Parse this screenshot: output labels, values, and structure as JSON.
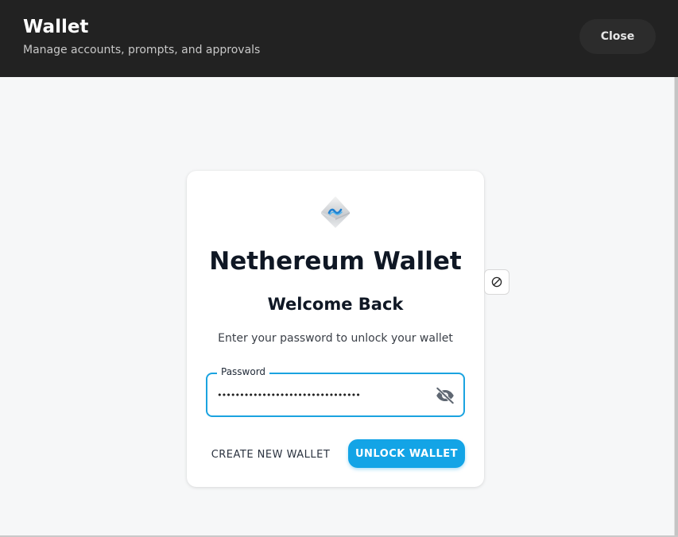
{
  "header": {
    "title": "Wallet",
    "subtitle": "Manage accounts, prompts, and approvals",
    "close_label": "Close"
  },
  "card": {
    "logo_icon": "nethereum-logo-icon",
    "app_title": "Nethereum Wallet",
    "welcome": "Welcome Back",
    "instructions": "Enter your password to unlock your wallet",
    "password": {
      "label": "Password",
      "value": "••••••••••••••••••••••••••••••••",
      "toggle_icon": "eye-off-icon"
    },
    "create_label": "CREATE NEW WALLET",
    "unlock_label": "UNLOCK WALLET"
  },
  "side_button": {
    "icon": "block-icon"
  },
  "colors": {
    "header_bg": "#222222",
    "accent": "#13a4e6",
    "title_text": "#0f1724",
    "page_bg": "#f6f7f8"
  }
}
